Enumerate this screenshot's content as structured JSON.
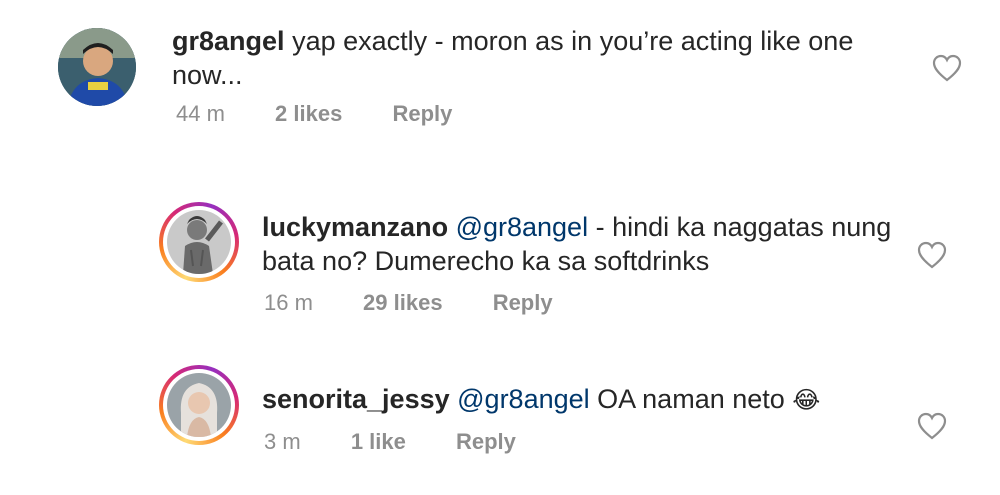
{
  "comments": [
    {
      "username": "gr8angel",
      "text_line1": "yap exactly - moron as in you’re acting like one",
      "text_line2": "now...",
      "time": "44 m",
      "likes": "2 likes",
      "reply": "Reply",
      "avatar_icon": "person-photo"
    },
    {
      "username": "luckymanzano",
      "mention": "@gr8angel",
      "text_line1_rest": " - hindi ka naggatas nung",
      "text_line2": "bata no? Dumerecho ka sa softdrinks",
      "time": "16 m",
      "likes": "29 likes",
      "reply": "Reply",
      "avatar_icon": "person-photo",
      "has_story_ring": true
    },
    {
      "username": "senorita_jessy",
      "mention": "@gr8angel",
      "text_rest": " OA naman neto",
      "emoji": "😂",
      "time": "3 m",
      "likes": "1 like",
      "reply": "Reply",
      "avatar_icon": "person-photo",
      "has_story_ring": true
    }
  ],
  "colors": {
    "text": "#262626",
    "meta": "#8e8e8e",
    "mention": "#00376b"
  }
}
